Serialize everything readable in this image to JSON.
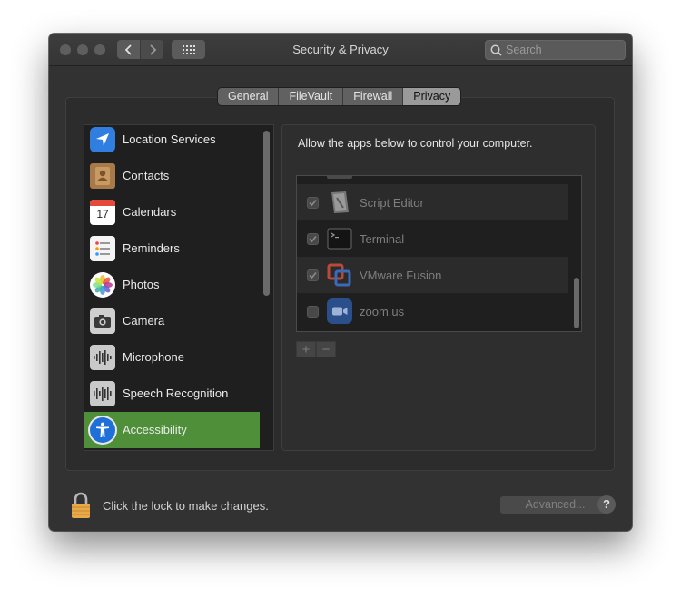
{
  "window": {
    "title": "Security & Privacy"
  },
  "search": {
    "placeholder": "Search"
  },
  "tabs": [
    {
      "label": "General",
      "active": false
    },
    {
      "label": "FileVault",
      "active": false
    },
    {
      "label": "Firewall",
      "active": false
    },
    {
      "label": "Privacy",
      "active": true
    }
  ],
  "sidebar": {
    "items": [
      {
        "label": "Location Services",
        "icon": "location-arrow-icon"
      },
      {
        "label": "Contacts",
        "icon": "contacts-book-icon"
      },
      {
        "label": "Calendars",
        "icon": "calendar-icon",
        "icon_text": "17"
      },
      {
        "label": "Reminders",
        "icon": "reminders-list-icon"
      },
      {
        "label": "Photos",
        "icon": "photos-flower-icon"
      },
      {
        "label": "Camera",
        "icon": "camera-icon"
      },
      {
        "label": "Microphone",
        "icon": "microphone-waveform-icon"
      },
      {
        "label": "Speech Recognition",
        "icon": "speech-waveform-icon"
      },
      {
        "label": "Accessibility",
        "icon": "accessibility-icon",
        "selected": true
      }
    ]
  },
  "privacy": {
    "description": "Allow the apps below to control your computer.",
    "apps": [
      {
        "name": "Script Editor",
        "checked": true,
        "icon": "script-editor-icon"
      },
      {
        "name": "Terminal",
        "checked": true,
        "icon": "terminal-icon"
      },
      {
        "name": "VMware Fusion",
        "checked": true,
        "icon": "vmware-fusion-icon"
      },
      {
        "name": "zoom.us",
        "checked": false,
        "icon": "zoom-camera-icon"
      }
    ],
    "add_label": "+",
    "remove_label": "−"
  },
  "footer": {
    "lock_text": "Click the lock to make changes.",
    "advanced_label": "Advanced...",
    "help_label": "?"
  },
  "colors": {
    "selection": "#4f8f39",
    "window_bg": "#323232",
    "list_bg": "#1f1f1f"
  }
}
